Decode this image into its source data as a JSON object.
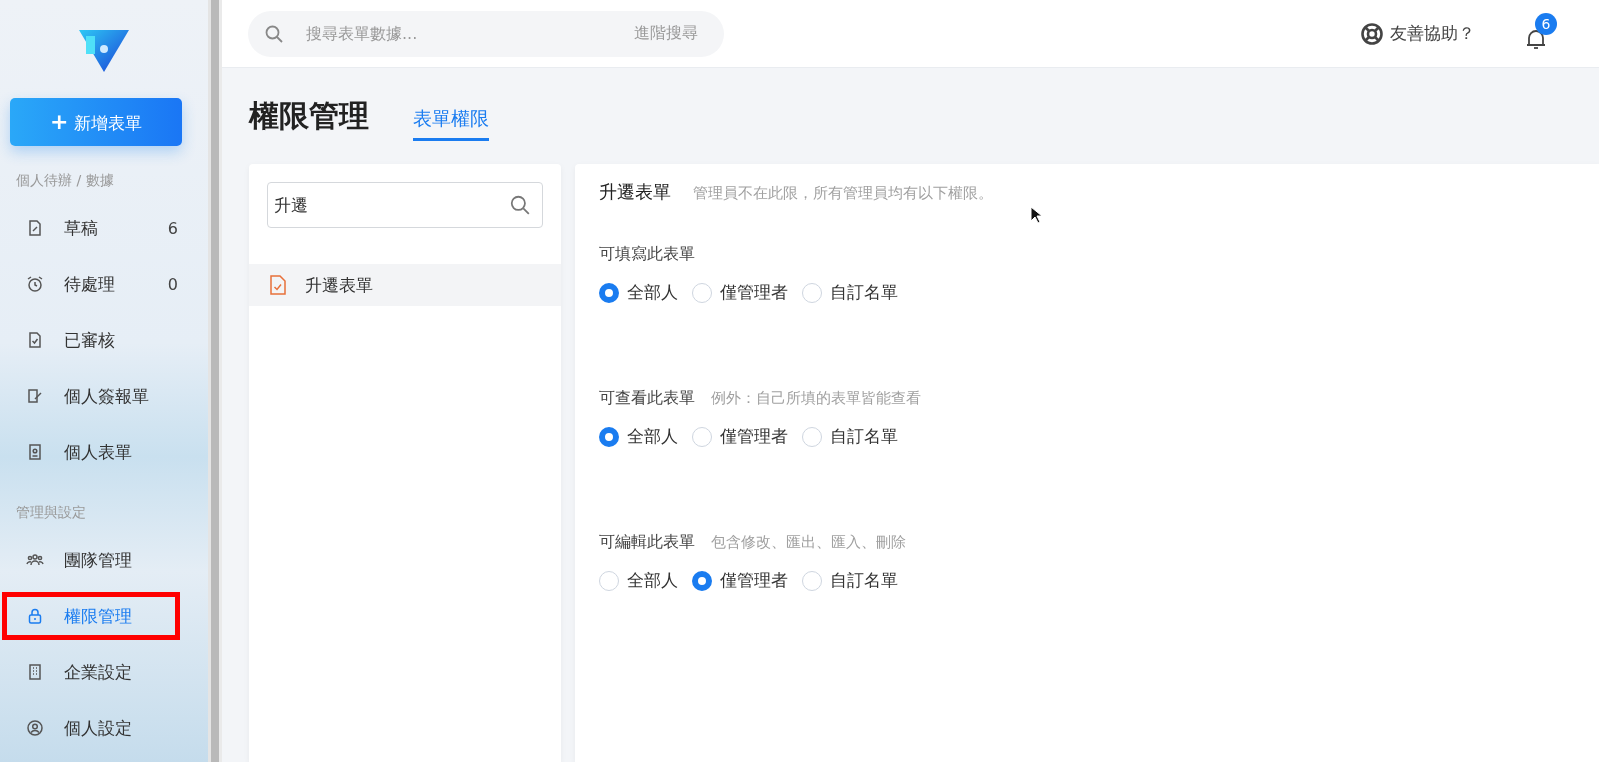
{
  "sidebar": {
    "new_button": {
      "icon": "+",
      "label": "新增表單"
    },
    "groups": [
      {
        "heading": "個人待辦 / 數據",
        "items": [
          {
            "label": "草稿",
            "count": "6",
            "selected": false,
            "highlighted": false
          },
          {
            "label": "待處理",
            "count": "0",
            "selected": false,
            "highlighted": false
          },
          {
            "label": "已審核",
            "selected": false,
            "highlighted": false
          },
          {
            "label": "個人簽報單",
            "selected": false,
            "highlighted": false
          },
          {
            "label": "個人表單",
            "selected": false,
            "highlighted": false
          }
        ]
      },
      {
        "heading": "管理與設定",
        "items": [
          {
            "label": "團隊管理",
            "selected": false,
            "highlighted": false
          },
          {
            "label": "權限管理",
            "selected": true,
            "highlighted": true
          },
          {
            "label": "企業設定",
            "selected": false,
            "highlighted": false
          },
          {
            "label": "個人設定",
            "selected": false,
            "highlighted": false
          }
        ]
      }
    ]
  },
  "top_bar": {
    "search": {
      "placeholder": "搜尋表單數據...",
      "advanced": "進階搜尋"
    },
    "help": "友善協助？",
    "notifications": {
      "badge": "6"
    }
  },
  "page": {
    "title": "權限管理",
    "tabs": [
      {
        "label": "表單權限",
        "selected": true
      }
    ]
  },
  "form_list": {
    "search": {
      "value": "升遷"
    },
    "items": [
      {
        "label": "升遷表單",
        "selected": true
      }
    ]
  },
  "permissions": {
    "form_name": "升遷表單",
    "note": "管理員不在此限，所有管理員均有以下權限。",
    "sections": [
      {
        "label": "可填寫此表單",
        "options": [
          {
            "label": "全部人",
            "selected": true
          },
          {
            "label": "僅管理者",
            "selected": false
          },
          {
            "label": "自訂名單",
            "selected": false
          }
        ]
      },
      {
        "label": "可查看此表單",
        "hint": "例外：自己所填的表單皆能查看",
        "options": [
          {
            "label": "全部人",
            "selected": true
          },
          {
            "label": "僅管理者",
            "selected": false
          },
          {
            "label": "自訂名單",
            "selected": false
          }
        ]
      },
      {
        "label": "可編輯此表單",
        "hint": "包含修改、匯出、匯入、刪除",
        "options": [
          {
            "label": "全部人",
            "selected": false
          },
          {
            "label": "僅管理者",
            "selected": true
          },
          {
            "label": "自訂名單",
            "selected": false
          }
        ]
      }
    ]
  }
}
